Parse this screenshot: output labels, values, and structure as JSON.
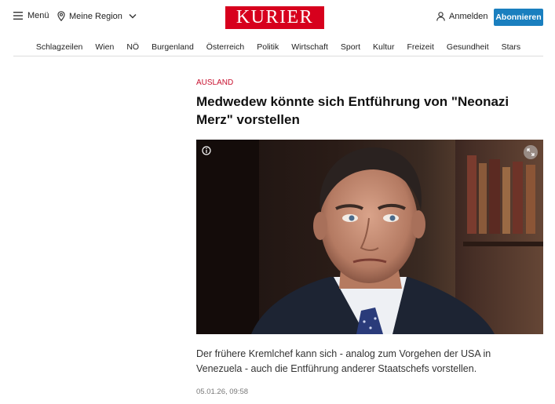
{
  "header": {
    "menu_label": "Menü",
    "region_label": "Meine Region",
    "logo_text": "KURIER",
    "login_label": "Anmelden",
    "subscribe_label": "Abonnieren"
  },
  "nav": [
    {
      "label": "Schlagzeilen"
    },
    {
      "label": "Wien"
    },
    {
      "label": "NÖ"
    },
    {
      "label": "Burgenland"
    },
    {
      "label": "Österreich"
    },
    {
      "label": "Politik"
    },
    {
      "label": "Wirtschaft"
    },
    {
      "label": "Sport"
    },
    {
      "label": "Kultur"
    },
    {
      "label": "Freizeit"
    },
    {
      "label": "Gesundheit"
    },
    {
      "label": "Stars"
    }
  ],
  "article": {
    "kicker": "AUSLAND",
    "headline": "Medwedew könnte sich Entführung von \"Neonazi Merz\" vorstellen",
    "teaser": "Der frühere Kremlchef kann sich - analog zum Vorgehen der USA in Venezuela - auch die Entführung anderer Staatschefs vorstellen.",
    "date": "05.01.26, 09:58"
  },
  "icons": {
    "menu": "hamburger-icon",
    "region": "location-pin-icon",
    "login": "user-icon",
    "image_info": "info-icon",
    "image_expand": "expand-icon"
  },
  "colors": {
    "brand_red": "#d7001d",
    "subscribe_blue": "#1a7fbf",
    "kicker_red": "#c8102e"
  }
}
